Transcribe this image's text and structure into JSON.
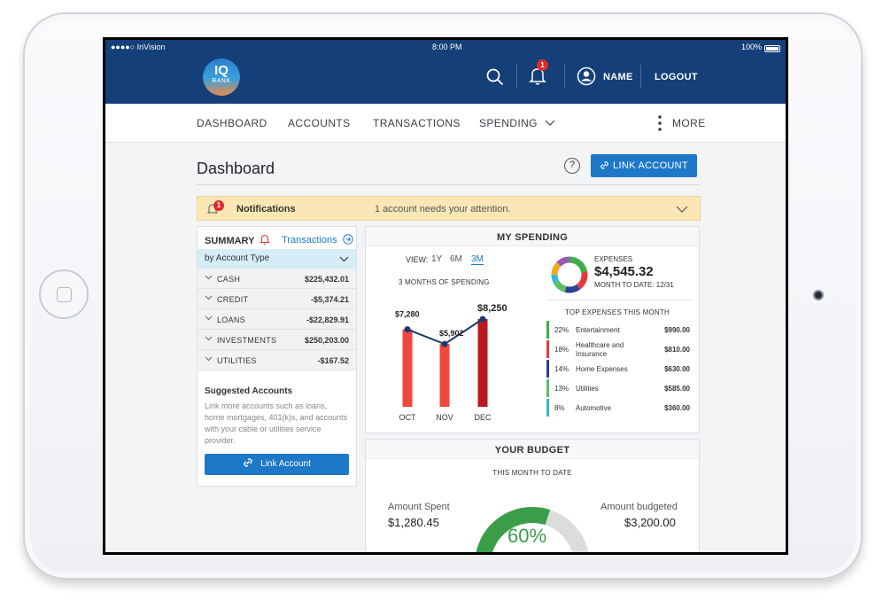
{
  "status_bar": {
    "carrier": "●●●●○ InVision",
    "time": "8:00 PM",
    "battery": "100%"
  },
  "header": {
    "logo_line1": "IQ",
    "logo_line2": "BANK",
    "notification_count": "1",
    "user_name": "NAME",
    "logout_label": "LOGOUT"
  },
  "nav": {
    "items": [
      {
        "label": "DASHBOARD"
      },
      {
        "label": "ACCOUNTS"
      },
      {
        "label": "TRANSACTIONS"
      },
      {
        "label": "SPENDING"
      }
    ],
    "more_label": "MORE"
  },
  "page": {
    "title": "Dashboard",
    "help_glyph": "?",
    "link_account_label": "LINK ACCOUNT"
  },
  "notifications": {
    "count": "1",
    "title": "Notifications",
    "message": "1 account needs your attention."
  },
  "summary": {
    "title": "SUMMARY",
    "transactions_link": "Transactions",
    "group_by": "by Account Type",
    "accounts": [
      {
        "name": "CASH",
        "value": "$225,432.01"
      },
      {
        "name": "CREDIT",
        "value": "-$5,374.21"
      },
      {
        "name": "LOANS",
        "value": "-$22,829.91"
      },
      {
        "name": "INVESTMENTS",
        "value": "$250,203.00"
      },
      {
        "name": "UTILITIES",
        "value": "-$167.52"
      }
    ],
    "suggested_title": "Suggested Accounts",
    "suggested_text": "Link more accounts such as loans, home mortgages, 401(k)s, and accounts with your cable or utilities service provider.",
    "link_button": "Link Account"
  },
  "spending": {
    "title": "MY SPENDING",
    "view_label": "VIEW:",
    "view_options": [
      "1Y",
      "6M",
      "3M"
    ],
    "view_selected": "3M",
    "chart_subtitle": "3 MONTHS OF SPENDING",
    "expenses_label": "EXPENSES",
    "expenses_value": "$4,545.32",
    "month_to_date": "MONTH TO DATE: 12/31",
    "top_expenses_title": "TOP EXPENSES THIS MONTH",
    "categories": [
      {
        "pct": "22%",
        "name": "Entertainment",
        "amount": "$990.00",
        "color": "#3fae49"
      },
      {
        "pct": "18%",
        "name": "Healthcare and Insurance",
        "amount": "$810.00",
        "color": "#e23b3b"
      },
      {
        "pct": "14%",
        "name": "Home Expenses",
        "amount": "$630.00",
        "color": "#2b3f9b"
      },
      {
        "pct": "13%",
        "name": "Utilities",
        "amount": "$585.00",
        "color": "#5cbf63"
      },
      {
        "pct": "8%",
        "name": "Automotive",
        "amount": "$360.00",
        "color": "#36b9d6"
      }
    ]
  },
  "chart_data": {
    "type": "bar",
    "categories": [
      "OCT",
      "NOV",
      "DEC"
    ],
    "values": [
      7280,
      5902,
      8250
    ],
    "value_labels": [
      "$7,280",
      "$5,902",
      "$8,250"
    ],
    "title": "3 MONTHS OF SPENDING",
    "ylim": [
      0,
      9000
    ],
    "colors": [
      "#f0483e",
      "#f0483e",
      "#b9191f"
    ],
    "line_color": "#1c3a6e",
    "grid": false
  },
  "budget": {
    "title": "YOUR BUDGET",
    "subtitle": "THIS MONTH TO DATE",
    "spent_label": "Amount Spent",
    "spent_value": "$1,280.45",
    "budgeted_label": "Amount budgeted",
    "budgeted_value": "$3,200.00",
    "percent_label": "60%",
    "percent": 0.6
  },
  "colors": {
    "brand_navy": "#143f78",
    "accent_blue": "#1e78c8",
    "alert_red": "#e02a2a",
    "notif_yellow": "#fbe7b5",
    "gauge_green": "#3a9e48",
    "gauge_gray": "#dcdcdc"
  }
}
